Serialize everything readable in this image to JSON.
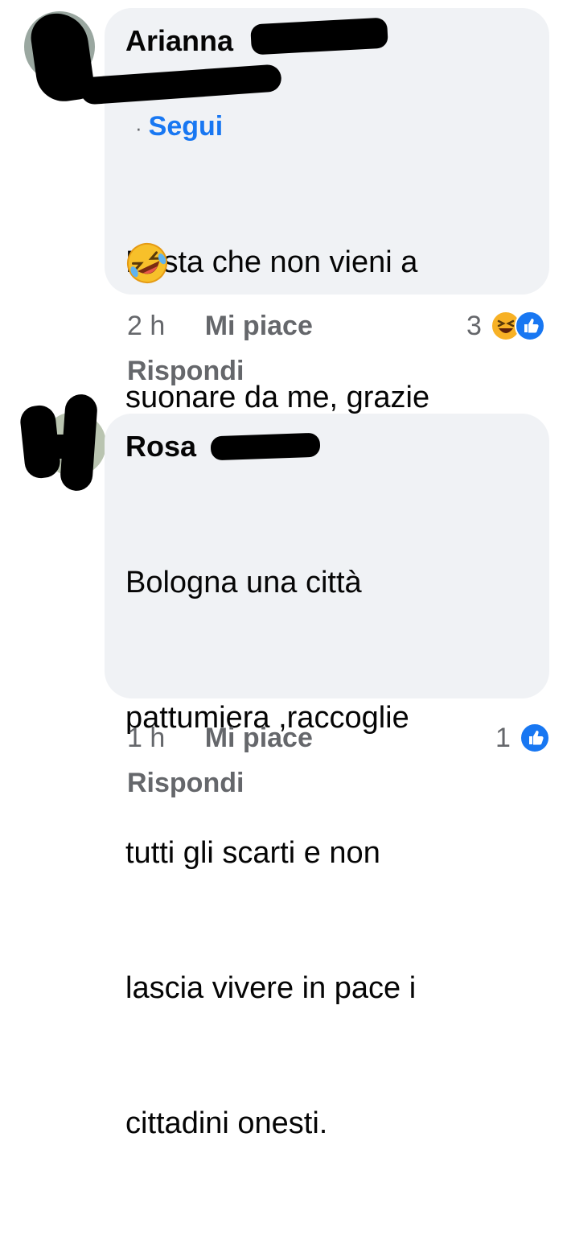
{
  "comments": [
    {
      "author": "Arianna",
      "follow_label": "Segui",
      "follow_dot": "·",
      "text_lines": [
        "Basta che non vieni a",
        "suonare da me, grazie"
      ],
      "emoji": "rolling-on-floor-laughing",
      "time": "2 h",
      "like_label": "Mi piace",
      "reply_label": "Rispondi",
      "reaction_count": "3",
      "reactions": [
        "haha-icon",
        "like-icon"
      ]
    },
    {
      "author": "Rosa",
      "text_lines": [
        "Bologna una città",
        "pattumiera ,raccoglie",
        "tutti gli scarti e non",
        "lascia vivere in pace i",
        "cittadini onesti."
      ],
      "time": "1 h",
      "like_label": "Mi piace",
      "reply_label": "Rispondi",
      "reaction_count": "1",
      "reactions": [
        "like-icon"
      ]
    }
  ],
  "colors": {
    "bubble": "#f0f2f5",
    "link": "#1877f2",
    "meta": "#65676b",
    "haha": "#f7b125",
    "like": "#1877f2"
  }
}
